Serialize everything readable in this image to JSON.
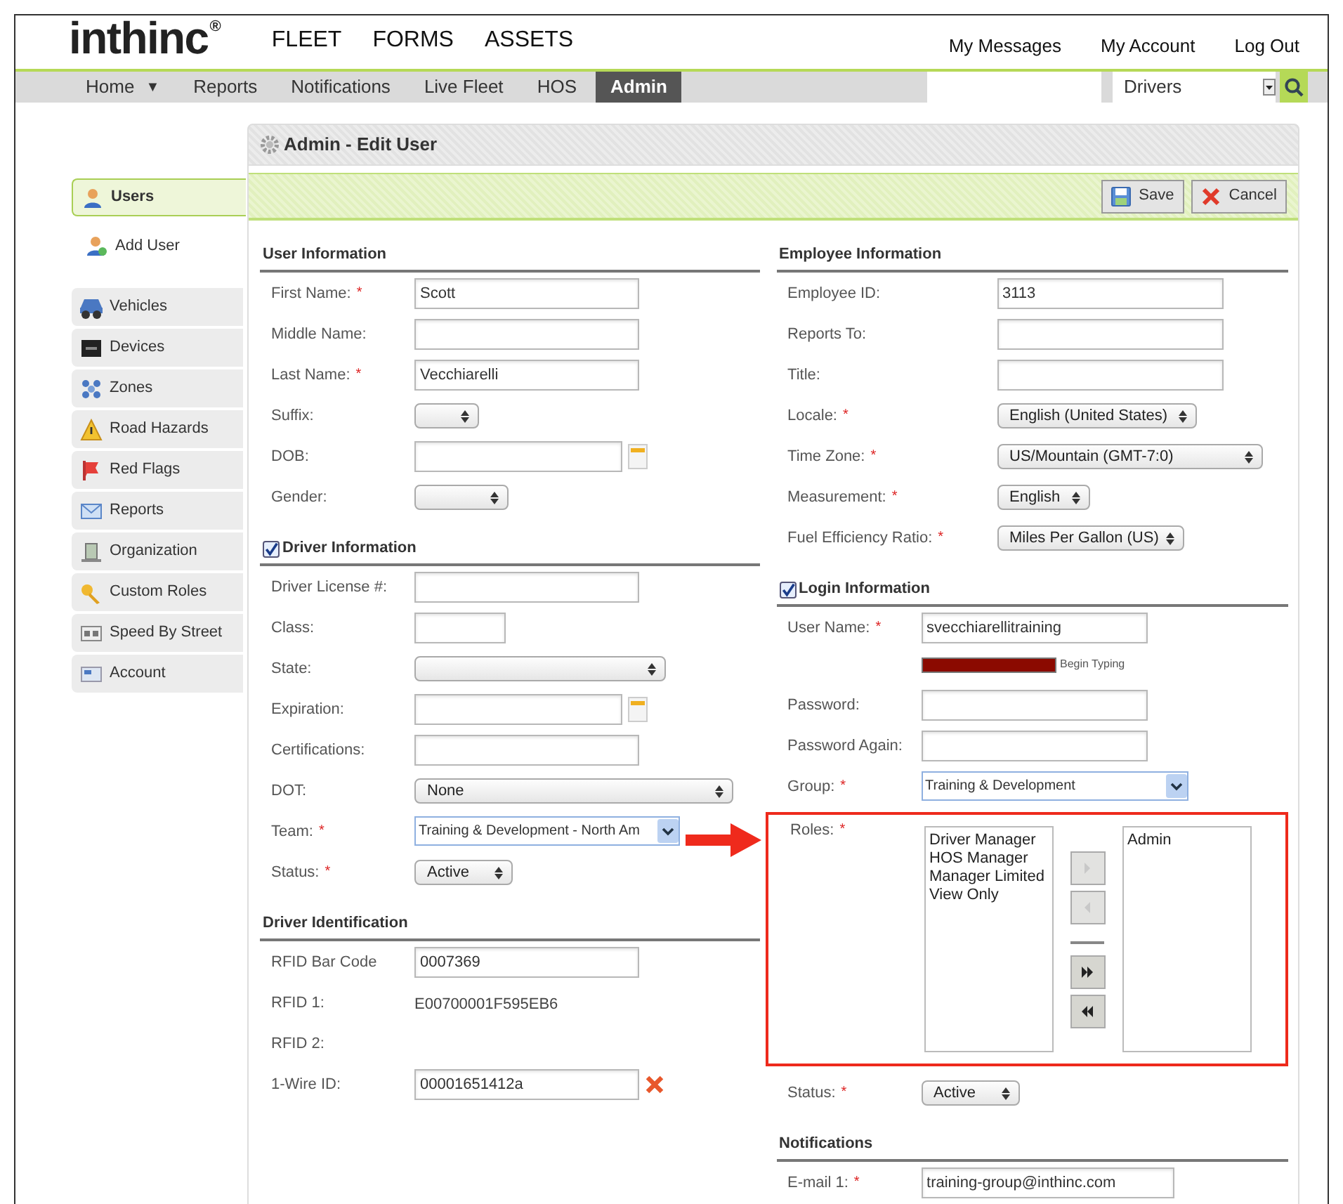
{
  "logo": {
    "name": "inthinc",
    "mark": "®"
  },
  "top_nav": [
    "FLEET",
    "FORMS",
    "ASSETS"
  ],
  "account_links": [
    "My Messages",
    "My Account",
    "Log Out"
  ],
  "menu": [
    {
      "label": "Home",
      "caret": "▼",
      "selected": false
    },
    {
      "label": "Reports",
      "selected": false
    },
    {
      "label": "Notifications",
      "selected": false
    },
    {
      "label": "Live Fleet",
      "selected": false
    },
    {
      "label": "HOS",
      "selected": false
    },
    {
      "label": "Admin",
      "selected": true
    }
  ],
  "scope_select": {
    "value": "Drivers"
  },
  "sidebar": [
    {
      "label": "Users",
      "kind": "primary",
      "selected": true
    },
    {
      "label": "Add User",
      "kind": "action",
      "selected": false
    },
    {
      "label": "Vehicles",
      "kind": "nav",
      "selected": false
    },
    {
      "label": "Devices",
      "kind": "nav",
      "selected": false
    },
    {
      "label": "Zones",
      "kind": "nav",
      "selected": false
    },
    {
      "label": "Road Hazards",
      "kind": "nav",
      "selected": false
    },
    {
      "label": "Red Flags",
      "kind": "nav",
      "selected": false
    },
    {
      "label": "Reports",
      "kind": "nav",
      "selected": false
    },
    {
      "label": "Organization",
      "kind": "nav",
      "selected": false
    },
    {
      "label": "Custom Roles",
      "kind": "nav",
      "selected": false
    },
    {
      "label": "Speed By Street",
      "kind": "nav",
      "selected": false
    },
    {
      "label": "Account",
      "kind": "nav",
      "selected": false
    }
  ],
  "page_title": "Admin - Edit User",
  "toolbar": [
    {
      "label": "Save",
      "kind": "save"
    },
    {
      "label": "Cancel",
      "kind": "cancel"
    }
  ],
  "columns": [
    [
      {
        "title": "User Information",
        "fields": [
          {
            "label": "First Name:",
            "required": "*",
            "kind": "text",
            "value": "Scott"
          },
          {
            "label": "Middle Name:",
            "kind": "text"
          },
          {
            "label": "Last Name:",
            "required": "*",
            "kind": "text",
            "value": "Vecchiarelli"
          },
          {
            "label": "Suffix:",
            "kind": "select"
          },
          {
            "label": "DOB:",
            "kind": "date"
          },
          {
            "label": "Gender:",
            "kind": "select"
          }
        ]
      },
      {
        "title": "Driver Information",
        "checked": true,
        "fields": [
          {
            "label": "Driver License #:",
            "kind": "text"
          },
          {
            "label": "Class:",
            "kind": "text"
          },
          {
            "label": "State:",
            "kind": "select"
          },
          {
            "label": "Expiration:",
            "kind": "date"
          },
          {
            "label": "Certifications:",
            "kind": "text"
          },
          {
            "label": "DOT:",
            "kind": "select",
            "value": "None"
          },
          {
            "label": "Team:",
            "required": "*",
            "kind": "combo",
            "value": "Training & Development - North Am"
          },
          {
            "label": "Status:",
            "required": "*",
            "kind": "select",
            "value": "Active"
          }
        ]
      },
      {
        "title": "Driver Identification",
        "fields": [
          {
            "label": "RFID Bar Code",
            "kind": "text",
            "value": "0007369"
          },
          {
            "label": "RFID 1:",
            "kind": "static",
            "value": "E00700001F595EB6"
          },
          {
            "label": "RFID 2:",
            "kind": "static"
          },
          {
            "label": "1-Wire ID:",
            "kind": "removable",
            "value": "00001651412a"
          }
        ]
      }
    ],
    [
      {
        "title": "Employee Information",
        "fields": [
          {
            "label": "Employee ID:",
            "kind": "text",
            "value": "3113"
          },
          {
            "label": "Reports To:",
            "kind": "text"
          },
          {
            "label": "Title:",
            "kind": "text"
          },
          {
            "label": "Locale:",
            "required": "*",
            "kind": "select",
            "value": "English (United States)"
          },
          {
            "label": "Time Zone:",
            "required": "*",
            "kind": "select",
            "value": "US/Mountain (GMT-7:0)"
          },
          {
            "label": "Measurement:",
            "required": "*",
            "kind": "select",
            "value": "English"
          },
          {
            "label": "Fuel Efficiency Ratio:",
            "required": "*",
            "kind": "select",
            "value": "Miles Per Gallon (US)"
          }
        ]
      },
      {
        "title": "Login Information",
        "checked": true,
        "fields": [
          {
            "label": "User Name:",
            "required": "*",
            "kind": "text",
            "value": "svecchiarellitraining"
          },
          {
            "kind": "strength",
            "hint": "Begin Typing"
          },
          {
            "label": "Password:",
            "kind": "text"
          },
          {
            "label": "Password Again:",
            "kind": "text"
          },
          {
            "label": "Group:",
            "required": "*",
            "kind": "combo",
            "value": "Training & Development"
          },
          {
            "label": "Roles:",
            "required": "*",
            "kind": "roles",
            "highlighted": true,
            "available": [
              "Driver Manager",
              "HOS Manager",
              "Manager Limited",
              "View Only"
            ],
            "assigned": [
              "Admin"
            ],
            "buttons": [
              {
                "kind": "add",
                "disabled": true
              },
              {
                "kind": "remove",
                "disabled": true
              },
              {
                "kind": "add_all",
                "disabled": false
              },
              {
                "kind": "remove_all",
                "disabled": false
              }
            ]
          },
          {
            "label": "Status:",
            "required": "*",
            "kind": "select",
            "value": "Active"
          }
        ]
      },
      {
        "title": "Notifications",
        "fields": [
          {
            "label": "E-mail 1:",
            "required": "*",
            "kind": "text",
            "value": "training-group@inthinc.com"
          }
        ]
      }
    ]
  ]
}
